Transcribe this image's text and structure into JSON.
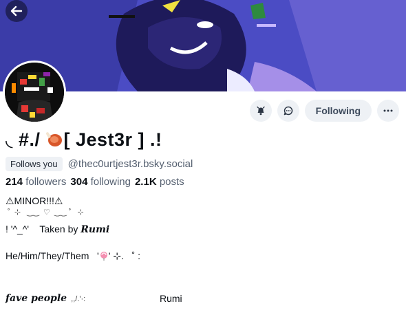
{
  "header": {
    "back_label": "",
    "banner_colors": [
      "#5a5fd0",
      "#2a2580",
      "#7a6ad8"
    ]
  },
  "actions": {
    "notify_icon": "bell-icon",
    "message_icon": "chat-bubble-icon",
    "follow_label": "Following",
    "more_icon": "ellipsis-icon"
  },
  "profile": {
    "display_name_prefix": "◟ #./ ",
    "display_name_main": "[ Jest3r ] .!",
    "follows_you": "Follows you",
    "handle": "@thec0urtjest3r.bsky.social",
    "followers_count": "214",
    "followers_label": "followers",
    "following_count": "304",
    "following_label": "following",
    "posts_count": "2.1K",
    "posts_label": "posts"
  },
  "bio": {
    "line1": "⚠MINOR!!!⚠",
    "line2": " ˚  ⊹   ‿‿  ♡  ‿‿ ˚   ⊹",
    "line3_prefix": "! '^_^'    Taken by ",
    "line3_name": "Rumi",
    "line4_prefix": "He/Him/They/Them   '",
    "line4_suffix": "' ⊹.   ˚ :",
    "line5_fave": "fave people",
    "line5_mid": "  ,,/.'·:",
    "line5_name": "Rumi"
  }
}
